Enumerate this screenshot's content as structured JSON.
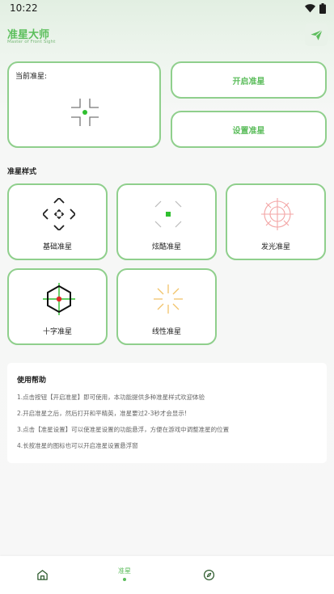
{
  "status_bar": {
    "time": "10:22"
  },
  "header": {
    "title": "准星大师",
    "subtitle": "Master of Front Sight",
    "share_icon": "paper-plane-icon"
  },
  "current_crosshair": {
    "label": "当前准星:"
  },
  "actions": {
    "open_label": "开启准星",
    "settings_label": "设置准星"
  },
  "styles": {
    "section_title": "准星样式",
    "items": [
      {
        "label": "基础准星",
        "icon": "basic-crosshair-icon"
      },
      {
        "label": "炫酷准星",
        "icon": "cool-crosshair-icon"
      },
      {
        "label": "发光准星",
        "icon": "glow-crosshair-icon"
      },
      {
        "label": "十字准星",
        "icon": "cross-crosshair-icon"
      },
      {
        "label": "线性准星",
        "icon": "linear-crosshair-icon"
      }
    ]
  },
  "help": {
    "title": "使用帮助",
    "items": [
      "1.点击按钮【开启准星】即可使用，本功能提供多种准星样式欢迎体验",
      "2.开启准星之后，然后打开和平精英，准星要过2-3秒才会显示!",
      "3.点击【准星设置】可以使准星设置的功能悬浮，方便在游戏中调整准星的位置",
      "4.长按准星的图标也可以开启准星设置悬浮窗"
    ]
  },
  "bottom_nav": {
    "items": [
      {
        "label": "",
        "icon": "home-icon"
      },
      {
        "label": "准星",
        "icon": "crosshair-tab",
        "active": true
      },
      {
        "label": "",
        "icon": "compass-icon"
      }
    ]
  },
  "colors": {
    "accent": "#5cbd5c",
    "card_border": "#8fcf8c"
  }
}
